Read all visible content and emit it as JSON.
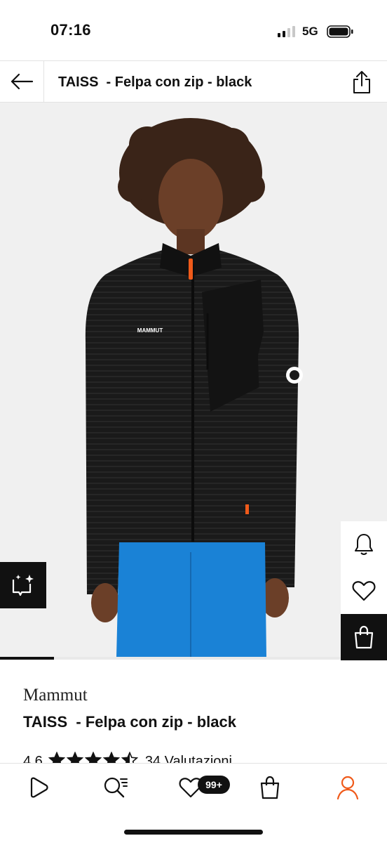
{
  "status_bar": {
    "time": "07:16",
    "network": "5G"
  },
  "header": {
    "title": "TAISS  - Felpa con zip - black"
  },
  "product": {
    "brand": "Mammut",
    "name": "TAISS  - Felpa con zip - black",
    "rating_value": "4,6",
    "rating_stars": 4.5,
    "rating_count": "34 Valutazioni",
    "image_brand_print": "MAMMUT",
    "image_progress": 0.14
  },
  "bottom_nav": {
    "wishlist_badge": "99+",
    "active_color": "#f05a1a",
    "items": [
      "play-icon",
      "search-list-icon",
      "heart-icon",
      "bag-icon",
      "account-icon"
    ]
  },
  "colors": {
    "accent": "#f05a1a",
    "shorts_blue": "#1a82d6",
    "jacket": "#1a1a1a"
  }
}
